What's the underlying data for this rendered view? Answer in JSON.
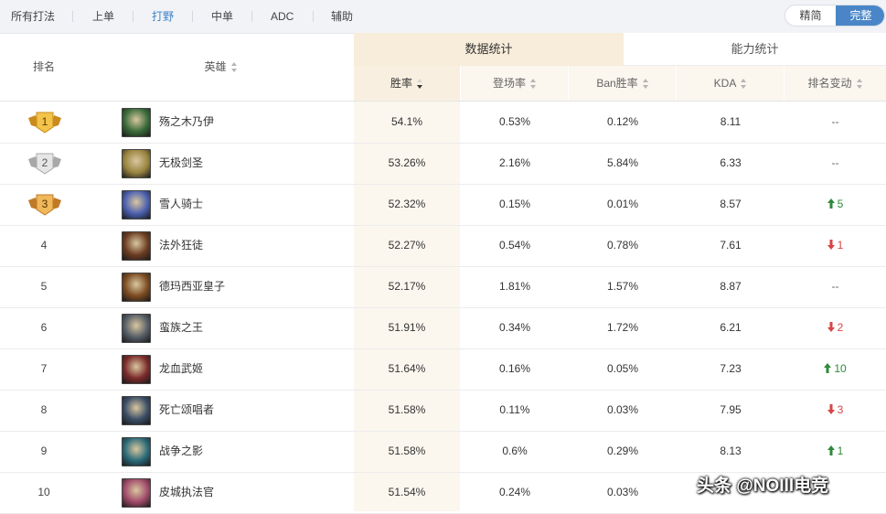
{
  "tabs": [
    {
      "label": "所有打法",
      "active": false
    },
    {
      "label": "上单",
      "active": false
    },
    {
      "label": "打野",
      "active": true
    },
    {
      "label": "中单",
      "active": false
    },
    {
      "label": "ADC",
      "active": false
    },
    {
      "label": "辅助",
      "active": false
    }
  ],
  "mode_toggle": {
    "simple": "精简",
    "full": "完整",
    "selected": "完整"
  },
  "table": {
    "col_rank": "排名",
    "col_hero": "英雄",
    "group_data": "数据统计",
    "group_ability": "能力统计",
    "columns": [
      "胜率",
      "登场率",
      "Ban胜率",
      "KDA",
      "排名变动"
    ],
    "sorted_column": "胜率",
    "rows": [
      {
        "rank": "1",
        "medal": "gold",
        "hero": "殇之木乃伊",
        "win": "54.1%",
        "pick": "0.53%",
        "ban": "0.12%",
        "kda": "8.11",
        "change": "--",
        "dir": "none",
        "avatar_color": "#3a6b3a"
      },
      {
        "rank": "2",
        "medal": "silver",
        "hero": "无极剑圣",
        "win": "53.26%",
        "pick": "2.16%",
        "ban": "5.84%",
        "kda": "6.33",
        "change": "--",
        "dir": "none",
        "avatar_color": "#9a8440"
      },
      {
        "rank": "3",
        "medal": "bronze",
        "hero": "雪人骑士",
        "win": "52.32%",
        "pick": "0.15%",
        "ban": "0.01%",
        "kda": "8.57",
        "change": "5",
        "dir": "up",
        "avatar_color": "#4a5fb0"
      },
      {
        "rank": "4",
        "medal": "",
        "hero": "法外狂徒",
        "win": "52.27%",
        "pick": "0.54%",
        "ban": "0.78%",
        "kda": "7.61",
        "change": "1",
        "dir": "down",
        "avatar_color": "#6b3c22"
      },
      {
        "rank": "5",
        "medal": "",
        "hero": "德玛西亚皇子",
        "win": "52.17%",
        "pick": "1.81%",
        "ban": "1.57%",
        "kda": "8.87",
        "change": "--",
        "dir": "none",
        "avatar_color": "#7a4a20"
      },
      {
        "rank": "6",
        "medal": "",
        "hero": "蛮族之王",
        "win": "51.91%",
        "pick": "0.34%",
        "ban": "1.72%",
        "kda": "6.21",
        "change": "2",
        "dir": "down",
        "avatar_color": "#555d66"
      },
      {
        "rank": "7",
        "medal": "",
        "hero": "龙血武姬",
        "win": "51.64%",
        "pick": "0.16%",
        "ban": "0.05%",
        "kda": "7.23",
        "change": "10",
        "dir": "up",
        "avatar_color": "#7a2a2a"
      },
      {
        "rank": "8",
        "medal": "",
        "hero": "死亡颂唱者",
        "win": "51.58%",
        "pick": "0.11%",
        "ban": "0.03%",
        "kda": "7.95",
        "change": "3",
        "dir": "down",
        "avatar_color": "#3a4d66"
      },
      {
        "rank": "9",
        "medal": "",
        "hero": "战争之影",
        "win": "51.58%",
        "pick": "0.6%",
        "ban": "0.29%",
        "kda": "8.13",
        "change": "1",
        "dir": "up",
        "avatar_color": "#2a6a78"
      },
      {
        "rank": "10",
        "medal": "",
        "hero": "皮城执法官",
        "win": "51.54%",
        "pick": "0.24%",
        "ban": "0.03%",
        "kda": "",
        "change": "",
        "dir": "none",
        "avatar_color": "#a04a6a"
      }
    ]
  },
  "watermark": "头条 @NOIll电竞",
  "colors": {
    "accent": "#4a86c7",
    "up": "#2f8a3a",
    "down": "#d64545",
    "group_header": "#f8ecda"
  }
}
